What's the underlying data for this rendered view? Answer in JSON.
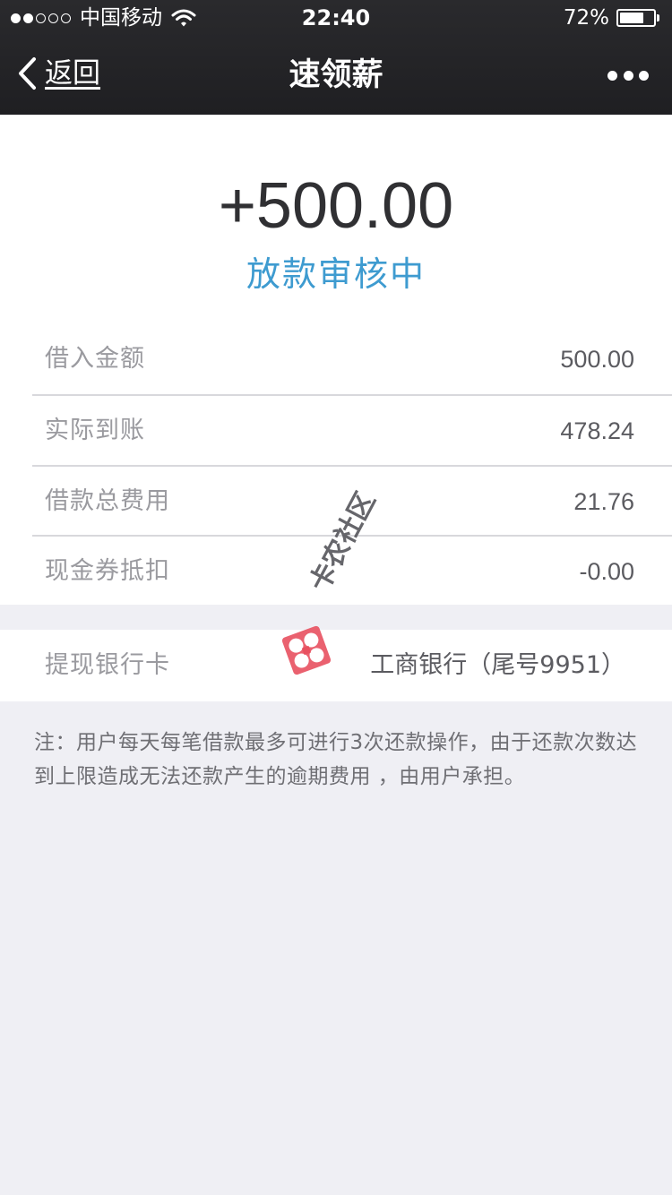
{
  "status_bar": {
    "carrier": "中国移动",
    "time": "22:40",
    "battery_percent": "72%",
    "battery_level": 0.72,
    "signal_bars": 2,
    "signal_total": 5
  },
  "nav": {
    "back_label": "返回",
    "title": "速领薪"
  },
  "summary": {
    "amount": "+500.00",
    "status": "放款审核中"
  },
  "details": [
    {
      "label": "借入金额",
      "value": "500.00"
    },
    {
      "label": "实际到账",
      "value": "478.24"
    },
    {
      "label": "借款总费用",
      "value": "21.76"
    },
    {
      "label": "现金券抵扣",
      "value": "-0.00"
    }
  ],
  "bank": {
    "label": "提现银行卡",
    "value": "工商银行（尾号9951）"
  },
  "note": "注：用户每天每笔借款最多可进行3次还款操作，由于还款次数达到上限造成无法还款产生的逾期费用 ，由用户承担。",
  "watermark": "卡农社区",
  "colors": {
    "nav_background": "#1f1f22",
    "status_blue": "#3e9bd0",
    "page_background": "#efeff4",
    "watermark_red": "#e8505f"
  }
}
